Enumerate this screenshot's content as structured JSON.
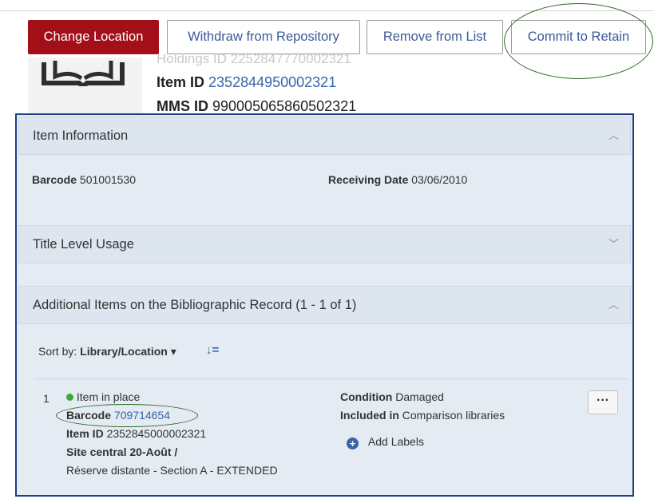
{
  "toolbar": {
    "change_location": "Change Location",
    "withdraw": "Withdraw from Repository",
    "remove": "Remove from List",
    "commit": "Commit to Retain"
  },
  "record": {
    "holdings_partial": "Holdings ID 2252847770002321",
    "item_id_label": "Item ID",
    "item_id_value": "2352844950002321",
    "mms_id_label": "MMS ID",
    "mms_id_value": "990005065860502321"
  },
  "item_information": {
    "title": "Item Information",
    "barcode_label": "Barcode",
    "barcode_value": "501001530",
    "receiving_label": "Receiving Date",
    "receiving_value": "03/06/2010"
  },
  "title_level_usage": {
    "title": "Title Level Usage"
  },
  "additional_items": {
    "title": "Additional Items on the Bibliographic Record (1 - 1 of 1)",
    "sort_label": "Sort by:",
    "sort_value": "Library/Location",
    "sort_caret": "▾",
    "sort_icon": "↓=",
    "item": {
      "index": "1",
      "status": "Item in place",
      "barcode_label": "Barcode",
      "barcode_value": "709714654",
      "item_id_label": "Item ID",
      "item_id_value": "2352845000002321",
      "location_line1": "Site central 20-Août  /",
      "location_line2": "Réserve distante - Section A - EXTENDED",
      "condition_label": "Condition",
      "condition_value": "Damaged",
      "included_label": "Included in",
      "included_value": "Comparison libraries",
      "add_labels": "Add Labels",
      "more": "···"
    }
  },
  "colors": {
    "primary_button": "#a30f18",
    "link": "#3465a8",
    "panel_border": "#1e3e86",
    "annotation": "#2f6b25",
    "status_dot": "#3ea83a"
  }
}
